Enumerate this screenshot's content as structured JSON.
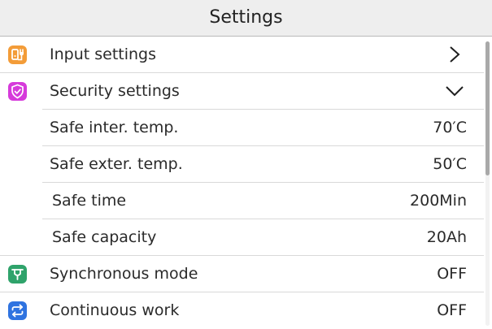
{
  "header": {
    "title": "Settings"
  },
  "rows": [
    {
      "label": "Input settings",
      "value": "",
      "icon": "input-plug-icon",
      "icon_color": "#F39C38",
      "control": "chevron-right"
    },
    {
      "label": "Security settings",
      "value": "",
      "icon": "shield-check-icon",
      "icon_color": "#D63ADB",
      "control": "chevron-down"
    },
    {
      "label": "Safe inter. temp.",
      "value": "70′C"
    },
    {
      "label": "Safe exter. temp.",
      "value": "50′C"
    },
    {
      "label": "Safe time",
      "value": "200Min"
    },
    {
      "label": "Safe capacity",
      "value": "20Ah"
    },
    {
      "label": "Synchronous mode",
      "value": "OFF",
      "icon": "sync-mode-icon",
      "icon_color": "#2FA36B"
    },
    {
      "label": "Continuous work",
      "value": "OFF",
      "icon": "repeat-icon",
      "icon_color": "#2F73E0"
    }
  ],
  "colors": {
    "header_bg": "#EEEEEE",
    "divider": "#D9D9D9",
    "scroll_thumb": "#A9A9A9"
  },
  "scrollbar": {
    "position_fraction": 0
  }
}
